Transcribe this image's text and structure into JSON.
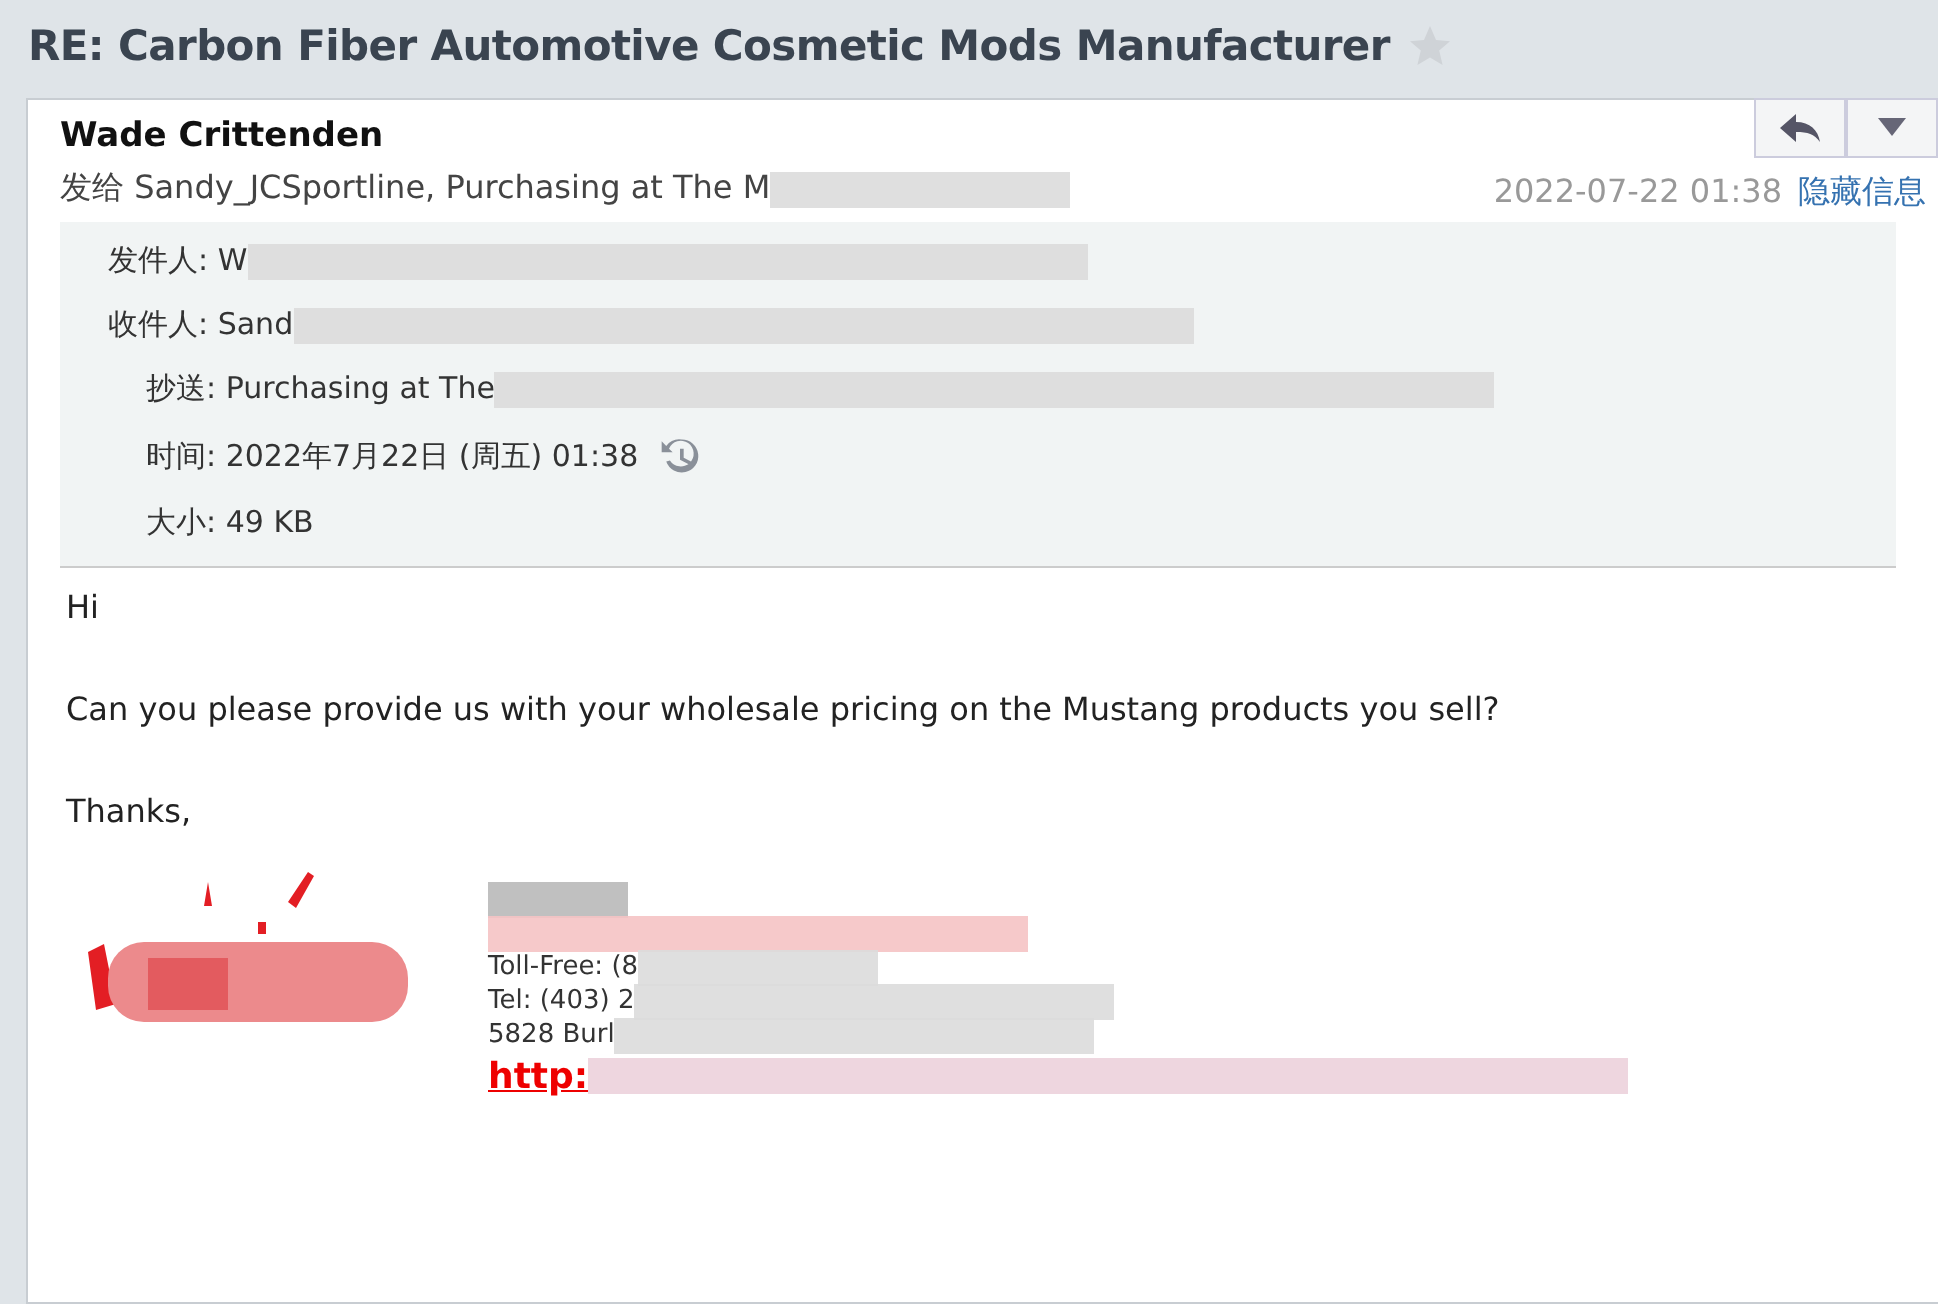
{
  "subject": {
    "title": "RE: Carbon Fiber Automotive Cosmetic Mods Manufacturer",
    "starred": false
  },
  "header": {
    "sender": "Wade Crittenden",
    "recipients": "发给 Sandy_JCSportline, Purchasing at The M",
    "date": "2022-07-22 01:38",
    "toggle_link": "隐藏信息"
  },
  "details": [
    {
      "label": "发件人:",
      "value": "W",
      "indent": false
    },
    {
      "label": "收件人:",
      "value": "Sand",
      "indent": false
    },
    {
      "label": "抄送:",
      "value": "Purchasing at The",
      "indent": true
    },
    {
      "label": "时间:",
      "value": "2022年7月22日 (周五) 01:38",
      "indent": true,
      "history": true
    },
    {
      "label": "大小:",
      "value": "49 KB",
      "indent": true
    }
  ],
  "body": [
    "Hi",
    "Can you please provide us with your wholesale pricing on the Mustang products you sell?",
    "Thanks,"
  ],
  "signature": {
    "lines": [
      "Toll-Free: (8",
      "Tel: (403) 2",
      "5828 Burl"
    ],
    "link": "http:"
  }
}
